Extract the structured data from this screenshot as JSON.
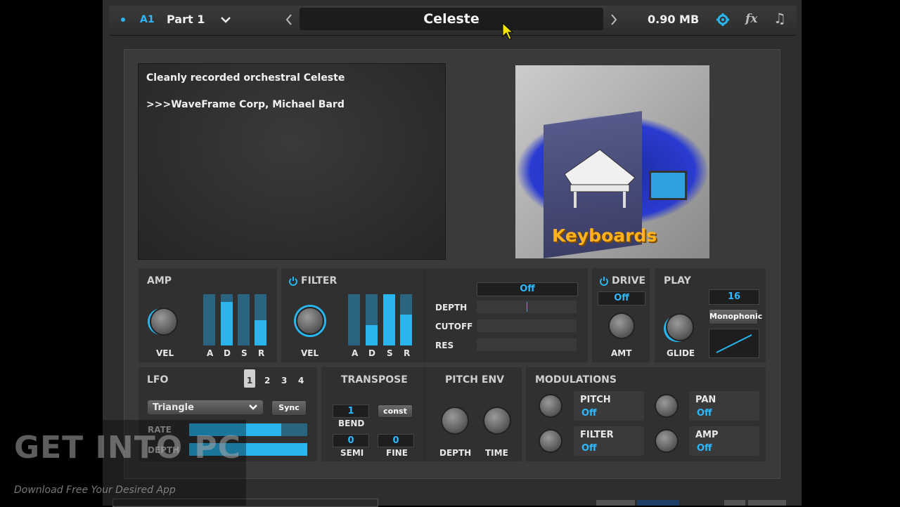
{
  "topbar": {
    "part_id": "A1",
    "part_name": "Part 1",
    "preset_name": "Celeste",
    "memory": "0.90 MB"
  },
  "info": {
    "line1": "Cleanly recorded orchestral Celeste",
    "line2": ">>>WaveFrame Corp, Michael Bard"
  },
  "image": {
    "caption": "Keyboards"
  },
  "amp": {
    "title": "AMP",
    "knob_label": "VEL",
    "adsr": [
      "A",
      "D",
      "S",
      "R"
    ],
    "levels": [
      0.0,
      0.85,
      0.0,
      0.5
    ]
  },
  "filter": {
    "title": "FILTER",
    "knob_label": "VEL",
    "adsr": [
      "A",
      "D",
      "S",
      "R"
    ],
    "levels": [
      0.0,
      0.4,
      1.0,
      0.6
    ],
    "mode": "Off",
    "params": [
      "DEPTH",
      "CUTOFF",
      "RES"
    ]
  },
  "drive": {
    "title": "DRIVE",
    "value": "Off",
    "knob_label": "AMT"
  },
  "play": {
    "title": "PLAY",
    "voices": "16",
    "mode_button": "Monophonic",
    "knob_label": "GLIDE"
  },
  "lfo": {
    "title": "LFO",
    "tabs": [
      "1",
      "2",
      "3",
      "4"
    ],
    "waveform": "Triangle",
    "sync": "Sync",
    "rate_label": "RATE",
    "depth_label": "DEPTH",
    "rate": 0.78,
    "depth": 1.0
  },
  "transpose": {
    "title": "TRANSPOSE",
    "bend_value": "1",
    "bend_label": "BEND",
    "const_button": "const",
    "semi_value": "0",
    "semi_label": "SEMI",
    "fine_value": "0",
    "fine_label": "FINE"
  },
  "pitch_env": {
    "title": "PITCH ENV",
    "depth_label": "DEPTH",
    "time_label": "TIME"
  },
  "modulations": {
    "title": "MODULATIONS",
    "items": [
      {
        "name": "PITCH",
        "value": "Off"
      },
      {
        "name": "PAN",
        "value": "Off"
      },
      {
        "name": "FILTER",
        "value": "Off"
      },
      {
        "name": "AMP",
        "value": "Off"
      }
    ]
  },
  "watermark": {
    "brand": "GET INTO PC",
    "tagline": "Download Free Your Desired App"
  },
  "colors": {
    "accent": "#29b6ef",
    "panel": "#3a3a3a",
    "section": "#303030"
  }
}
